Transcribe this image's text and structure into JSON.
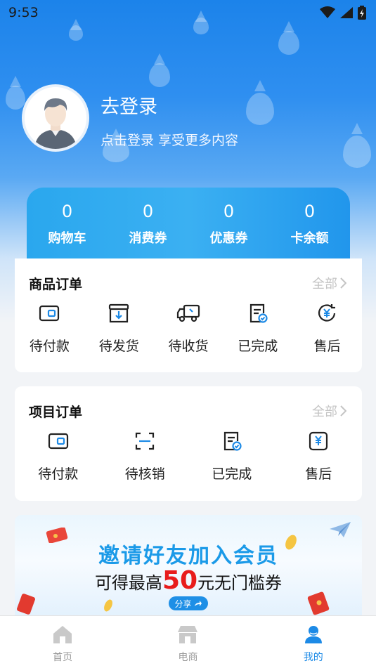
{
  "status_bar": {
    "time": "9:53"
  },
  "colors": {
    "accent": "#1d8ae6",
    "hero": "#1c83ea",
    "banner_red": "#e81c1c"
  },
  "profile": {
    "title": "去登录",
    "subtitle": "点击登录 享受更多内容"
  },
  "stats": [
    {
      "value": "0",
      "label": "购物车"
    },
    {
      "value": "0",
      "label": "消费券"
    },
    {
      "value": "0",
      "label": "优惠券"
    },
    {
      "value": "0",
      "label": "卡余额"
    }
  ],
  "goods_orders": {
    "title": "商品订单",
    "more": "全部",
    "items": [
      {
        "label": "待付款",
        "icon": "wallet-icon"
      },
      {
        "label": "待发货",
        "icon": "box-download-icon"
      },
      {
        "label": "待收货",
        "icon": "truck-icon"
      },
      {
        "label": "已完成",
        "icon": "document-check-icon"
      },
      {
        "label": "售后",
        "icon": "yen-refresh-icon"
      }
    ]
  },
  "project_orders": {
    "title": "项目订单",
    "more": "全部",
    "items": [
      {
        "label": "待付款",
        "icon": "wallet-icon"
      },
      {
        "label": "待核销",
        "icon": "scan-icon"
      },
      {
        "label": "已完成",
        "icon": "document-check-icon"
      },
      {
        "label": "售后",
        "icon": "yen-card-icon"
      }
    ]
  },
  "banner": {
    "title": "邀请好友加入会员",
    "sub_prefix": "可得最高",
    "sub_amount": "50",
    "sub_suffix": "元无门槛券",
    "share_label": "分享"
  },
  "tabbar": [
    {
      "label": "首页",
      "icon": "home-icon",
      "active": false
    },
    {
      "label": "电商",
      "icon": "store-icon",
      "active": false
    },
    {
      "label": "我的",
      "icon": "user-icon",
      "active": true
    }
  ]
}
